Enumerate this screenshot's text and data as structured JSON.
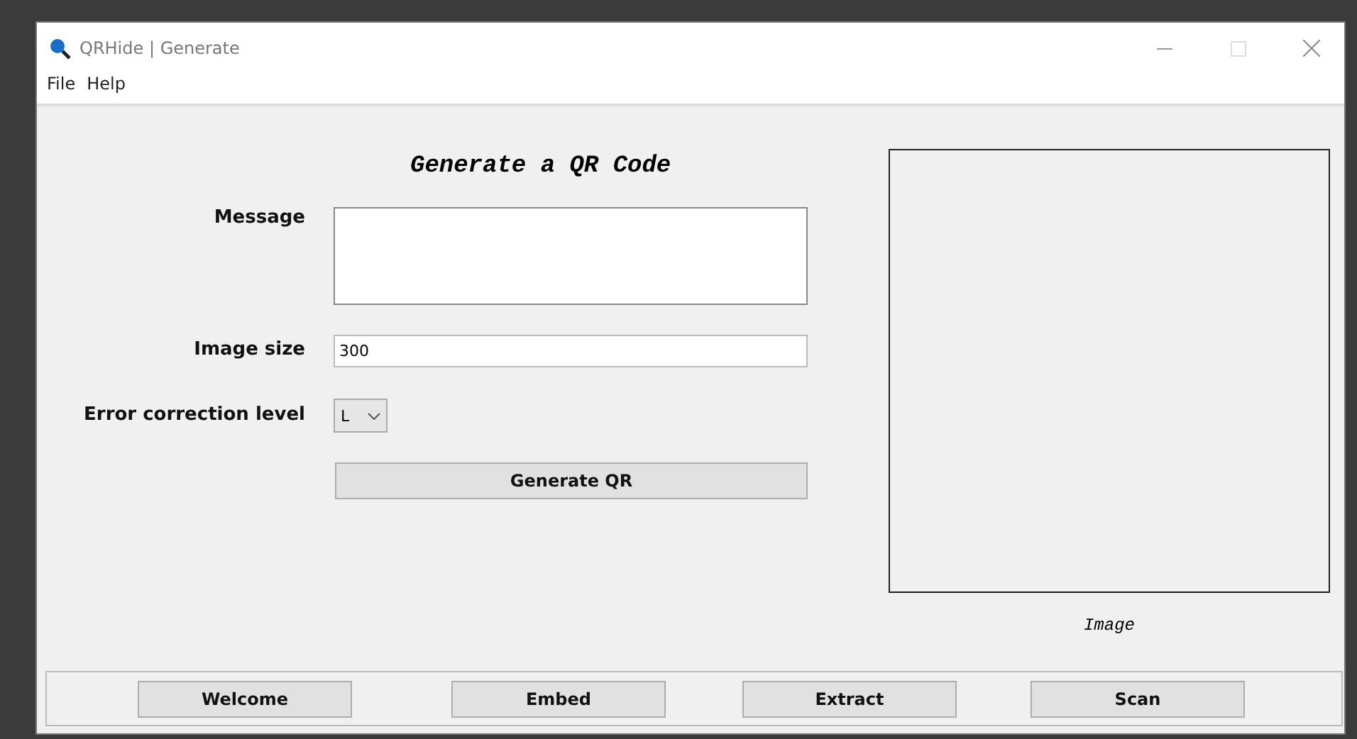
{
  "window": {
    "title": "QRHide | Generate"
  },
  "menu": [
    "File",
    "Help"
  ],
  "heading": "Generate a QR Code",
  "form": {
    "message_label": "Message",
    "size_label": "Image size",
    "size_value": "300",
    "ecl_label": "Error correction level",
    "ecl_value": "L",
    "generate_button": "Generate QR"
  },
  "image_caption": "Image",
  "nav_buttons": [
    "Welcome",
    "Embed",
    "Extract",
    "Scan"
  ]
}
